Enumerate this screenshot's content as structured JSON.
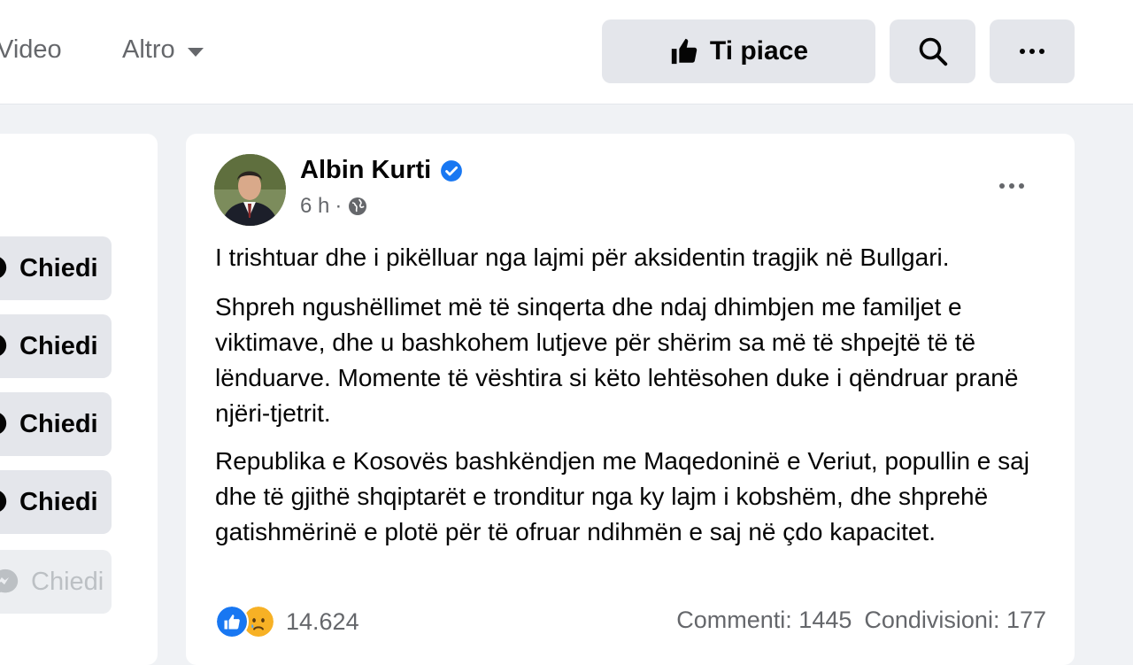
{
  "nav": {
    "video_label": "Video",
    "altro_label": "Altro"
  },
  "actions": {
    "like_label": "Ti piace"
  },
  "sidebar": {
    "buttons": [
      {
        "label": "Chiedi",
        "enabled": true
      },
      {
        "label": "Chiedi",
        "enabled": true
      },
      {
        "label": "Chiedi",
        "enabled": true
      },
      {
        "label": "Chiedi",
        "enabled": true
      },
      {
        "label": "Chiedi",
        "enabled": false
      }
    ]
  },
  "post": {
    "author": "Albin Kurti",
    "verified": true,
    "time": "6 h",
    "separator": "·",
    "audience_icon": "globe-icon",
    "paragraphs": [
      "I trishtuar dhe i pikëlluar nga lajmi për aksidentin tragjik në Bullgari.",
      "Shpreh ngushëllimet më të sinqerta dhe ndaj dhimbjen me familjet e viktimave, dhe u bashkohem lutjeve për shërim sa më të shpejtë të të lënduarve. Momente të vështira si këto lehtësohen duke i qëndruar pranë njëri-tjetrit.",
      "Republika e Kosovës bashkëndjen me Maqedoninë e Veriut, popullin e saj dhe të gjithë shqiptarët e tronditur nga ky lajm i kobshëm, dhe shprehë gatishmërinë e plotë për të ofruar ndihmën e saj në çdo kapacitet."
    ],
    "reaction_icons": [
      "like-reaction-icon",
      "sad-reaction-icon"
    ],
    "reaction_count": "14.624",
    "comments": "Commenti: 1445",
    "shares": "Condivisioni: 177"
  },
  "colors": {
    "background": "#f0f2f5",
    "card": "#ffffff",
    "button": "#e4e6eb",
    "verified": "#1877f2",
    "secondary_text": "#65676b"
  }
}
